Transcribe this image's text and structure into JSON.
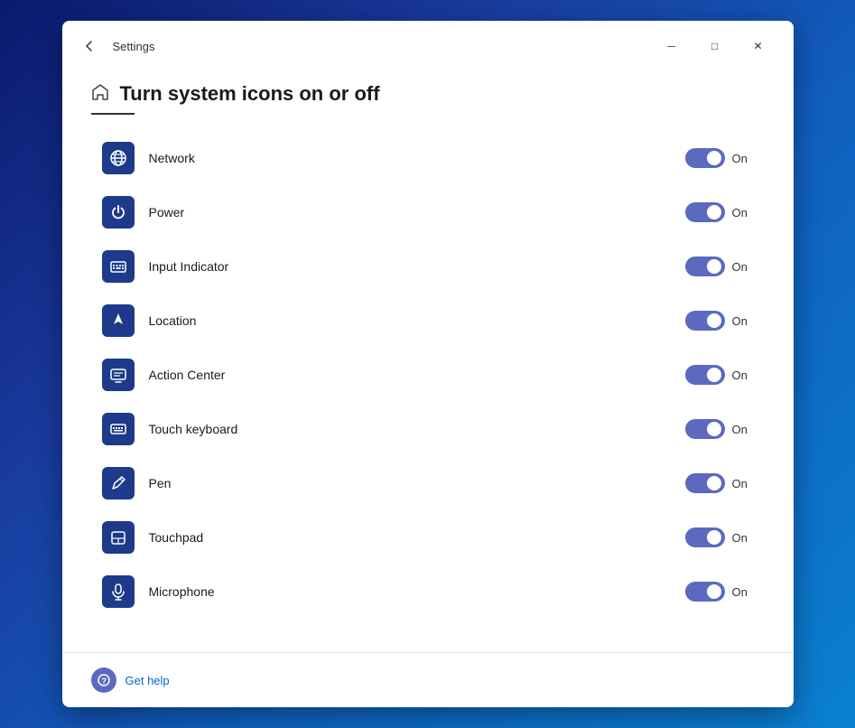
{
  "window": {
    "app_title": "Settings",
    "page_title": "Turn system icons on or off",
    "back_button_label": "←",
    "controls": {
      "minimize": "─",
      "maximize": "□",
      "close": "✕"
    }
  },
  "settings": [
    {
      "id": "network",
      "name": "Network",
      "icon": "network",
      "state": "On",
      "enabled": true
    },
    {
      "id": "power",
      "name": "Power",
      "icon": "power",
      "state": "On",
      "enabled": true
    },
    {
      "id": "input-indicator",
      "name": "Input Indicator",
      "icon": "keyboard",
      "state": "On",
      "enabled": true
    },
    {
      "id": "location",
      "name": "Location",
      "icon": "location",
      "state": "On",
      "enabled": true
    },
    {
      "id": "action-center",
      "name": "Action Center",
      "icon": "action-center",
      "state": "On",
      "enabled": true
    },
    {
      "id": "touch-keyboard",
      "name": "Touch keyboard",
      "icon": "touch-keyboard",
      "state": "On",
      "enabled": true
    },
    {
      "id": "pen",
      "name": "Pen",
      "icon": "pen",
      "state": "On",
      "enabled": true
    },
    {
      "id": "touchpad",
      "name": "Touchpad",
      "icon": "touchpad",
      "state": "On",
      "enabled": true
    },
    {
      "id": "microphone",
      "name": "Microphone",
      "icon": "microphone",
      "state": "On",
      "enabled": true
    }
  ],
  "footer": {
    "help_text": "Get help"
  }
}
